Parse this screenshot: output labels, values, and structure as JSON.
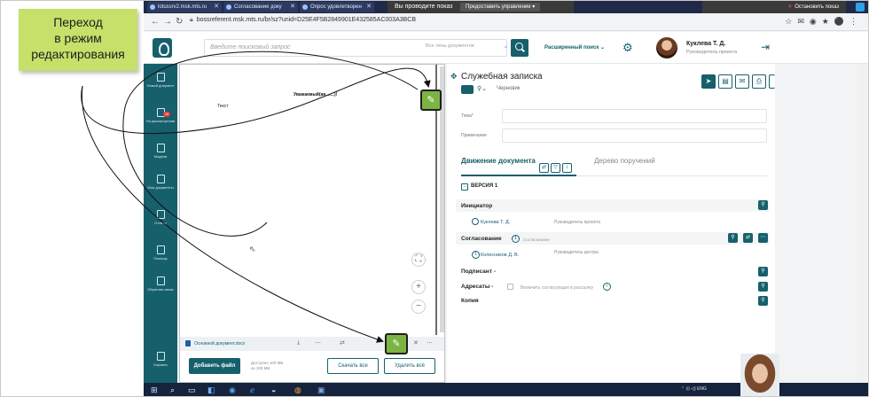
{
  "callout": {
    "line1": "Переход",
    "line2": "в режим",
    "line3": "редактирования"
  },
  "browser": {
    "tabs": [
      {
        "label": "lotussrv2.msk.mts.ru"
      },
      {
        "label": "Согласование доку"
      },
      {
        "label": "Опрос удовлетворен"
      }
    ],
    "share_text": "Вы проводите показ",
    "share_control": "Предоставить управление",
    "stop_share": "Остановить показ",
    "url": "bossreferent.msk.mts.ru/br/sz?unid=D25E4F5B2849901E432585AC003A3BCB"
  },
  "header": {
    "search_placeholder": "Введите поисковый запрос",
    "doc_types": "Все типы документов",
    "advanced_search": "Расширенный поиск",
    "user_name": "Куклева Т. Д.",
    "user_role": "Руководитель проекта"
  },
  "sidebar": {
    "items": [
      {
        "label": "Новый документ"
      },
      {
        "label": "На рассмотрении",
        "badge": "15"
      },
      {
        "label": "Модели"
      },
      {
        "label": "Мои документы"
      },
      {
        "label": "Отчеты"
      },
      {
        "label": "Помощь"
      },
      {
        "label": "Обратная связь"
      },
      {
        "label": "Корзина"
      }
    ]
  },
  "viewer": {
    "doc_heading": "Уважаемый(ая ......)!",
    "doc_text": "Текст",
    "file_name": "Основной документ.docx",
    "add_file": "Добавить файл",
    "limit_note": "Доступно 100 МБ из 100 МБ",
    "download_all": "Скачать все",
    "delete_all": "Удалить всё"
  },
  "pane": {
    "title": "Служебная записка",
    "status": "Черновик",
    "topic_label": "Тема*",
    "note_label": "Примечание",
    "tab_movement": "Движение документа",
    "tab_tree": "Дерево поручений",
    "version": "ВЕРСИЯ 1",
    "initiator_label": "Инициатор",
    "initiator_name": "Куклева Т. Д.",
    "initiator_role": "Руководитель проекта",
    "approval_label": "Согласование",
    "approval_count": "1",
    "approval_status": "Согласование",
    "approver_name": "Колесников Д. В.",
    "approver_role": "Руководитель центра",
    "signer_label": "Подписант -",
    "recipients_label": "Адресаты -",
    "include_approvers": "Включить согласующих в рассылку",
    "copy_label": "Копия"
  },
  "taskbar": {
    "lang": "ENG"
  },
  "colors": {
    "accent": "#16606c",
    "edit_green": "#7cb342",
    "callout": "#c7e06a"
  }
}
